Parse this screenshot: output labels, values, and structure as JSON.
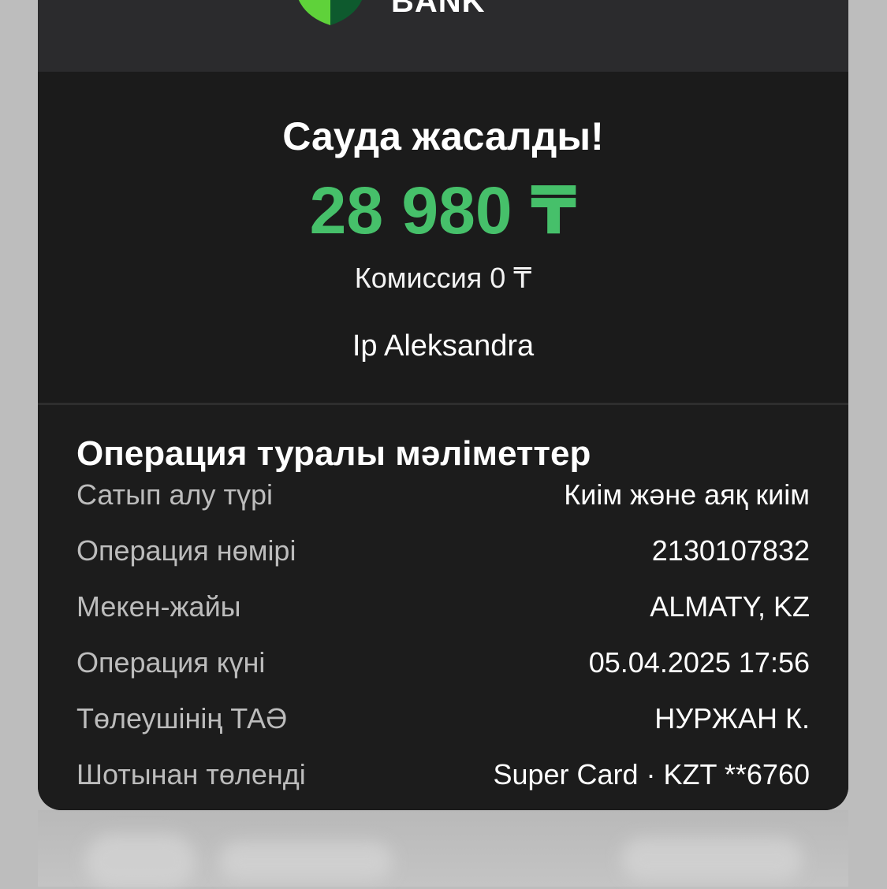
{
  "header": {
    "logo_text": "BANK",
    "colors": {
      "shield_light": "#5fd23a",
      "shield_dark": "#0e5a2e"
    }
  },
  "summary": {
    "title": "Сауда жасалды!",
    "amount": "28 980 ₸",
    "commission": "Комиссия 0 ₸",
    "merchant": "Ip Aleksandra",
    "amount_color": "#46c06a"
  },
  "details": {
    "title": "Операция туралы мәліметтер",
    "rows": [
      {
        "label": "Сатып алу түрі",
        "value": "Киім және аяқ киім"
      },
      {
        "label": "Операция нөмірі",
        "value": "2130107832"
      },
      {
        "label": "Мекен-жайы",
        "value": "ALMATY, KZ"
      },
      {
        "label": "Операция күні",
        "value": "05.04.2025 17:56"
      },
      {
        "label": "Төлеушінің ТАӘ",
        "value": "НУРЖАН К."
      },
      {
        "label": "Шотынан төленді",
        "value": "Super Card · KZT **6760"
      }
    ]
  }
}
